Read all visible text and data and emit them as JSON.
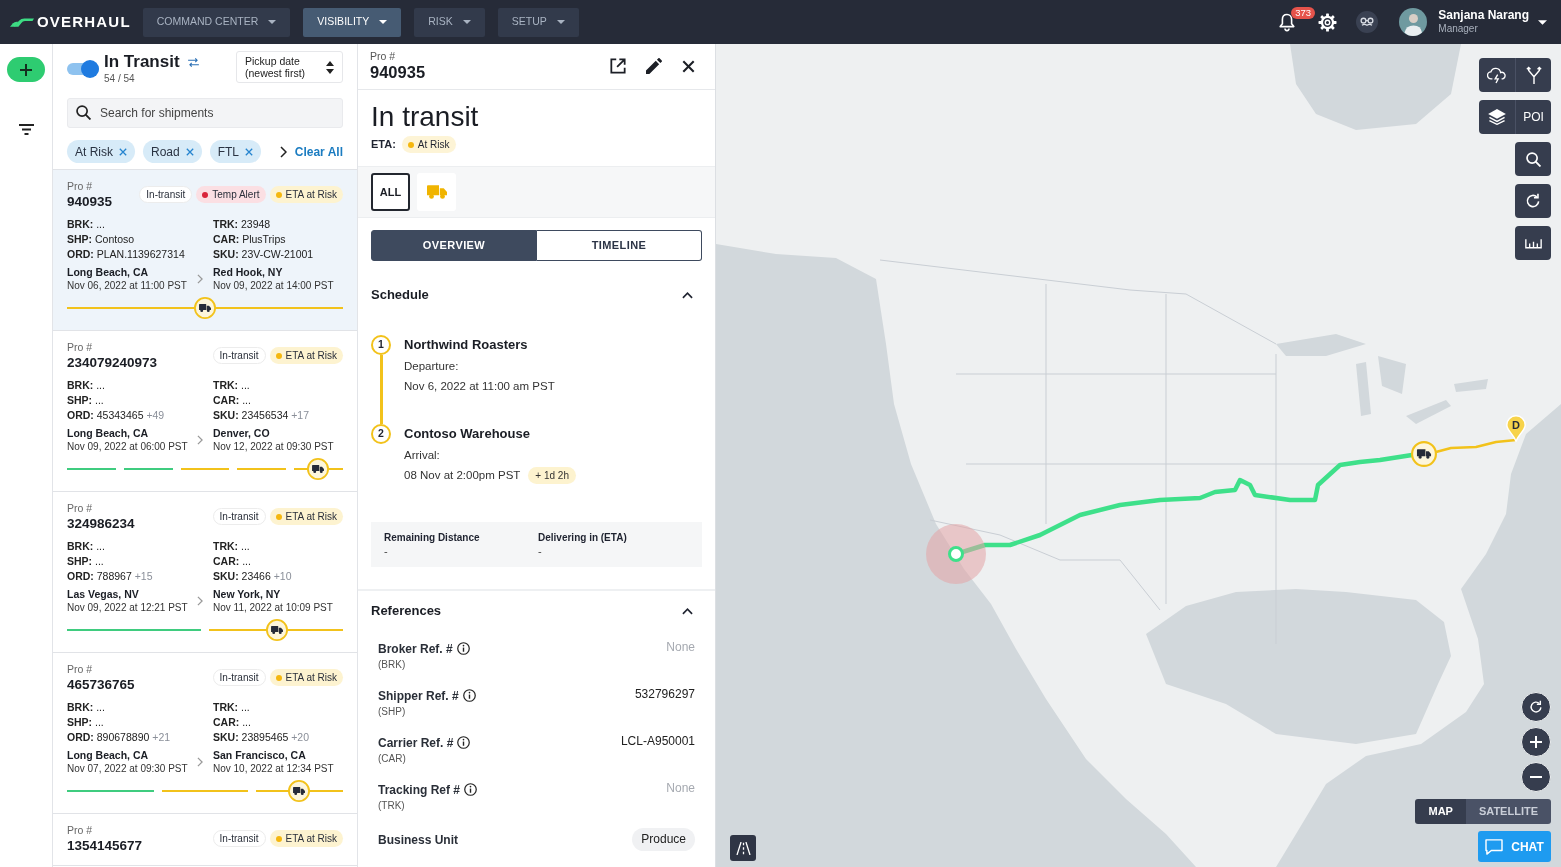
{
  "navbar": {
    "logo": "OVERHAUL",
    "menus": [
      {
        "label": "COMMAND CENTER",
        "selected": false
      },
      {
        "label": "VISIBILITY",
        "selected": true
      },
      {
        "label": "RISK",
        "selected": false
      },
      {
        "label": "SETUP",
        "selected": false
      }
    ],
    "notification_count": "373",
    "user": {
      "name": "Sanjana Narang",
      "role": "Manager"
    }
  },
  "shipment_list": {
    "live_toggle": {
      "on": true
    },
    "title": "In Transit",
    "count": "54 / 54",
    "sort": "Pickup date (newest first)",
    "search": {
      "placeholder": "Search for shipments"
    },
    "filters": [
      "At Risk",
      "Road",
      "FTL"
    ],
    "clear_all": "Clear All",
    "shipments": [
      {
        "selected": true,
        "pro_label": "Pro #",
        "pro": "940935",
        "badges": [
          {
            "kind": "status",
            "label": "In-transit"
          },
          {
            "kind": "alert",
            "label": "Temp Alert"
          },
          {
            "kind": "risk",
            "label": "ETA at Risk"
          }
        ],
        "fields_left": [
          {
            "label": "BRK:",
            "value": "..."
          },
          {
            "label": "SHP:",
            "value": "Contoso"
          },
          {
            "label": "ORD:",
            "value": "PLAN.1139627314"
          }
        ],
        "fields_right": [
          {
            "label": "TRK:",
            "value": "23948"
          },
          {
            "label": "CAR:",
            "value": "PlusTrips"
          },
          {
            "label": "SKU:",
            "value": "23V-CW-21001"
          }
        ],
        "origin": {
          "city": "Long Beach, CA",
          "time": "Nov 06, 2022 at 11:00 PST"
        },
        "destination": {
          "city": "Red Hook, NY",
          "time": "Nov 09, 2022 at 14:00 PST"
        },
        "legs": [
          {
            "completed": false
          }
        ],
        "level": 0.5
      },
      {
        "selected": false,
        "pro_label": "Pro #",
        "pro": "234079240973",
        "badges": [
          {
            "kind": "status",
            "label": "In-transit"
          },
          {
            "kind": "risk",
            "label": "ETA at Risk"
          }
        ],
        "fields_left": [
          {
            "label": "BRK:",
            "value": "..."
          },
          {
            "label": "SHP:",
            "value": "..."
          },
          {
            "label": "ORD:",
            "value": "45343465",
            "extra": "+49"
          }
        ],
        "fields_right": [
          {
            "label": "TRK:",
            "value": "..."
          },
          {
            "label": "CAR:",
            "value": "..."
          },
          {
            "label": "SKU:",
            "value": "23456534",
            "extra": "+17"
          }
        ],
        "origin": {
          "city": "Long Beach, CA",
          "time": "Nov 09, 2022 at 06:00 PST"
        },
        "destination": {
          "city": "Denver, CO",
          "time": "Nov 12, 2022 at 09:30 PST"
        },
        "legs": [
          {
            "completed": true
          },
          {
            "completed": true
          },
          {
            "completed": false
          },
          {
            "completed": false
          },
          {
            "completed": false
          }
        ],
        "level": 0.91
      },
      {
        "selected": false,
        "pro_label": "Pro #",
        "pro": "324986234",
        "badges": [
          {
            "kind": "status",
            "label": "In-transit"
          },
          {
            "kind": "risk",
            "label": "ETA at Risk"
          }
        ],
        "fields_left": [
          {
            "label": "BRK:",
            "value": "..."
          },
          {
            "label": "SHP:",
            "value": "..."
          },
          {
            "label": "ORD:",
            "value": "788967",
            "extra": "+15"
          }
        ],
        "fields_right": [
          {
            "label": "TRK:",
            "value": "..."
          },
          {
            "label": "CAR:",
            "value": "..."
          },
          {
            "label": "SKU:",
            "value": "23466",
            "extra": "+10"
          }
        ],
        "origin": {
          "city": "Las Vegas, NV",
          "time": "Nov 09, 2022 at 12:21 PST"
        },
        "destination": {
          "city": "New York, NY",
          "time": "Nov 11, 2022 at 10:09 PST"
        },
        "legs": [
          {
            "completed": true
          },
          {
            "completed": false
          }
        ],
        "level": 0.76
      },
      {
        "selected": false,
        "pro_label": "Pro #",
        "pro": "465736765",
        "badges": [
          {
            "kind": "status",
            "label": "In-transit"
          },
          {
            "kind": "risk",
            "label": "ETA at Risk"
          }
        ],
        "fields_left": [
          {
            "label": "BRK:",
            "value": "..."
          },
          {
            "label": "SHP:",
            "value": "..."
          },
          {
            "label": "ORD:",
            "value": "890678890",
            "extra": "+21"
          }
        ],
        "fields_right": [
          {
            "label": "TRK:",
            "value": "..."
          },
          {
            "label": "CAR:",
            "value": "..."
          },
          {
            "label": "SKU:",
            "value": "23895465",
            "extra": "+20"
          }
        ],
        "origin": {
          "city": "Long Beach, CA",
          "time": "Nov 07, 2022 at 09:30 PST"
        },
        "destination": {
          "city": "San Francisco, CA",
          "time": "Nov 10, 2022 at 12:34 PST"
        },
        "legs": [
          {
            "completed": true
          },
          {
            "completed": false
          },
          {
            "completed": false
          }
        ],
        "level": 0.84
      },
      {
        "selected": false,
        "pro_label": "Pro #",
        "pro": "1354145677",
        "badges": [
          {
            "kind": "status",
            "label": "In-transit"
          },
          {
            "kind": "risk",
            "label": "ETA at Risk"
          }
        ]
      }
    ]
  },
  "detail": {
    "pro_label": "Pro #",
    "pro": "940935",
    "status": "In transit",
    "eta_label": "ETA:",
    "eta_status": "At Risk",
    "modes": [
      {
        "kind": "all",
        "label": "ALL",
        "selected": true
      },
      {
        "kind": "truck",
        "selected": false
      }
    ],
    "tabs": [
      {
        "label": "OVERVIEW",
        "selected": true
      },
      {
        "label": "TIMELINE",
        "selected": false
      }
    ],
    "schedule": {
      "title": "Schedule",
      "expanded": true,
      "stops": [
        {
          "number": "1",
          "name": "Northwind Roasters",
          "event": "Departure:",
          "time": "Nov 6, 2022 at 11:00 am PST"
        },
        {
          "number": "2",
          "name": "Contoso Warehouse",
          "event": "Arrival:",
          "time": "08 Nov at 2:00pm PST",
          "delay": "+ 1d 2h"
        }
      ]
    },
    "stats": [
      {
        "label": "Remaining Distance",
        "value": "-"
      },
      {
        "label": "Delivering in (ETA)",
        "value": "-"
      }
    ],
    "references": {
      "title": "References",
      "expanded": true,
      "rows": [
        {
          "kind": "empty",
          "label": "Broker Ref. #",
          "info": true,
          "code": "(BRK)",
          "value": "None"
        },
        {
          "kind": "text",
          "label": "Shipper Ref. #",
          "info": true,
          "code": "(SHP)",
          "value": "532796297"
        },
        {
          "kind": "text",
          "label": "Carrier Ref. #",
          "info": true,
          "code": "(CAR)",
          "value": "LCL-A950001"
        },
        {
          "kind": "empty",
          "label": "Tracking Ref #",
          "info": true,
          "code": "(TRK)",
          "value": "None"
        },
        {
          "kind": "tag",
          "label": "Business Unit",
          "info": false,
          "value": "Produce"
        }
      ]
    }
  },
  "map": {
    "destination_label": "D",
    "poi": "POI",
    "view_modes": [
      {
        "label": "MAP",
        "selected": true
      },
      {
        "label": "SATELLITE",
        "selected": false
      }
    ],
    "chat": "CHAT"
  }
}
